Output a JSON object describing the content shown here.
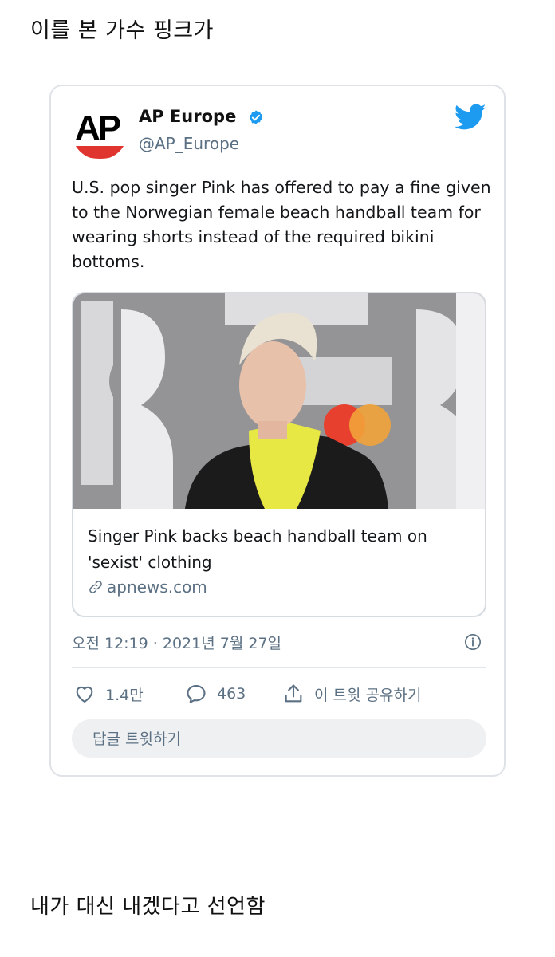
{
  "captions": {
    "top": "이를 본 가수 핑크가",
    "bottom": "내가 대신 내겠다고 선언함"
  },
  "tweet": {
    "author_name": "AP Europe",
    "author_handle": "@AP_Europe",
    "avatar_text": "AP",
    "text": "U.S. pop singer Pink has offered to pay a fine given to the Norwegian female beach handball team for wearing shorts instead of the required bikini bottoms.",
    "link_card": {
      "title": "Singer Pink backs beach handball team on 'sexist' clothing",
      "domain": "apnews.com"
    },
    "timestamp": "오전 12:19 · 2021년 7월 27일",
    "likes": "1.4만",
    "replies": "463",
    "share_label": "이 트윗 공유하기",
    "reply_prompt": "답글 트윗하기"
  },
  "colors": {
    "twitter_blue": "#1d9bf0",
    "ap_red": "#e0342f",
    "muted_text": "#5b7083"
  },
  "icons": [
    "verified-badge-icon",
    "twitter-bird-icon",
    "link-icon",
    "info-icon",
    "heart-icon",
    "reply-bubble-icon",
    "share-icon"
  ]
}
